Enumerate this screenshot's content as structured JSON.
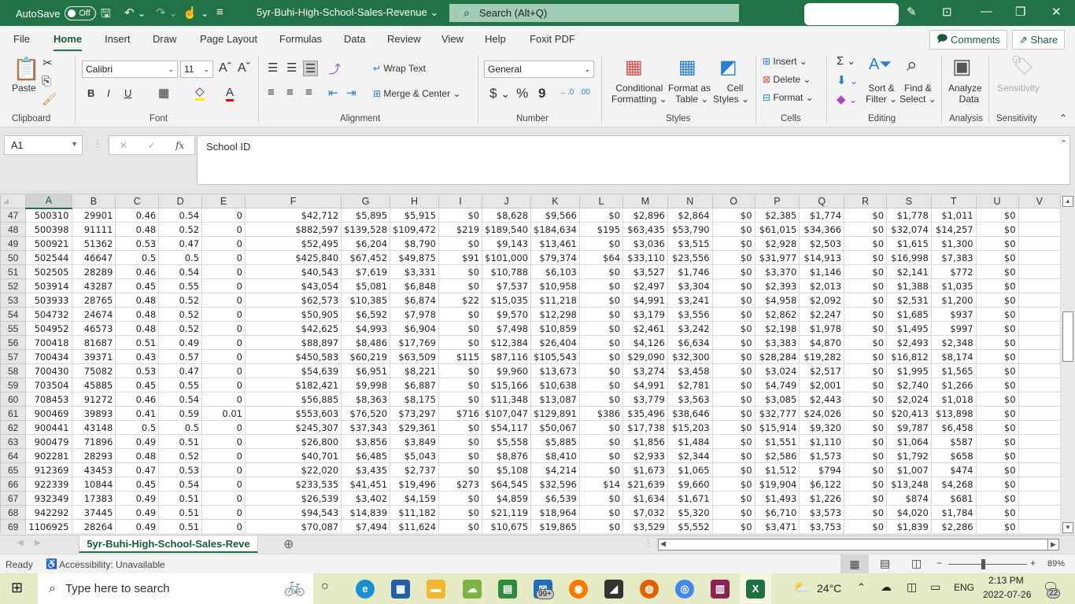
{
  "titlebar": {
    "autosave_label": "AutoSave",
    "autosave_state": "Off",
    "doc_title": "5yr-Buhi-High-School-Sales-Revenue ⌄",
    "search_placeholder": "Search (Alt+Q)"
  },
  "menu": {
    "tabs": [
      "File",
      "Home",
      "Insert",
      "Draw",
      "Page Layout",
      "Formulas",
      "Data",
      "Review",
      "View",
      "Help",
      "Foxit PDF"
    ],
    "active": "Home",
    "comments_label": "Comments",
    "share_label": "Share"
  },
  "ribbon": {
    "clipboard": {
      "paste": "Paste",
      "label": "Clipboard"
    },
    "font": {
      "family": "Calibri",
      "size": "11",
      "label": "Font",
      "bold": "B",
      "italic": "I",
      "underline": "U"
    },
    "alignment": {
      "wrap_text": "Wrap Text",
      "merge_center": "Merge & Center",
      "label": "Alignment"
    },
    "number": {
      "format": "General",
      "currency": "$",
      "percent": "%",
      "comma": "9",
      "label": "Number"
    },
    "styles": {
      "conditional_1": "Conditional",
      "conditional_2": "Formatting ⌄",
      "format_table_1": "Format as",
      "format_table_2": "Table ⌄",
      "cell_styles_1": "Cell",
      "cell_styles_2": "Styles ⌄",
      "label": "Styles"
    },
    "cells": {
      "insert": "Insert ⌄",
      "delete": "Delete ⌄",
      "format": "Format ⌄",
      "label": "Cells"
    },
    "editing": {
      "sort_1": "Sort &",
      "sort_2": "Filter ⌄",
      "find_1": "Find &",
      "find_2": "Select ⌄",
      "label": "Editing"
    },
    "analysis": {
      "analyze_1": "Analyze",
      "analyze_2": "Data",
      "label": "Analysis"
    },
    "sensitivity": {
      "button": "Sensitivity",
      "label": "Sensitivity"
    }
  },
  "formula_bar": {
    "name_box": "A1",
    "content": "School ID"
  },
  "sheet": {
    "columns": [
      "A",
      "B",
      "C",
      "D",
      "E",
      "F",
      "G",
      "H",
      "I",
      "J",
      "K",
      "L",
      "M",
      "N",
      "O",
      "P",
      "Q",
      "R",
      "S",
      "T",
      "U",
      "V"
    ],
    "rows": [
      {
        "n": "47",
        "cells": [
          "500310",
          "29901",
          "0.46",
          "0.54",
          "0",
          "$42,712",
          "$5,895",
          "$5,915",
          "$0",
          "$8,628",
          "$9,566",
          "$0",
          "$2,896",
          "$2,864",
          "$0",
          "$2,385",
          "$1,774",
          "$0",
          "$1,778",
          "$1,011",
          "$0",
          ""
        ]
      },
      {
        "n": "48",
        "cells": [
          "500398",
          "91111",
          "0.48",
          "0.52",
          "0",
          "$882,597",
          "$139,528",
          "$109,472",
          "$219",
          "$189,540",
          "$184,634",
          "$195",
          "$63,435",
          "$53,790",
          "$0",
          "$61,015",
          "$34,366",
          "$0",
          "$32,074",
          "$14,257",
          "$0",
          ""
        ]
      },
      {
        "n": "49",
        "cells": [
          "500921",
          "51362",
          "0.53",
          "0.47",
          "0",
          "$52,495",
          "$6,204",
          "$8,790",
          "$0",
          "$9,143",
          "$13,461",
          "$0",
          "$3,036",
          "$3,515",
          "$0",
          "$2,928",
          "$2,503",
          "$0",
          "$1,615",
          "$1,300",
          "$0",
          ""
        ]
      },
      {
        "n": "50",
        "cells": [
          "502544",
          "46647",
          "0.5",
          "0.5",
          "0",
          "$425,840",
          "$67,452",
          "$49,875",
          "$91",
          "$101,000",
          "$79,374",
          "$64",
          "$33,110",
          "$23,556",
          "$0",
          "$31,977",
          "$14,913",
          "$0",
          "$16,998",
          "$7,383",
          "$0",
          ""
        ]
      },
      {
        "n": "51",
        "cells": [
          "502505",
          "28289",
          "0.46",
          "0.54",
          "0",
          "$40,543",
          "$7,619",
          "$3,331",
          "$0",
          "$10,788",
          "$6,103",
          "$0",
          "$3,527",
          "$1,746",
          "$0",
          "$3,370",
          "$1,146",
          "$0",
          "$2,141",
          "$772",
          "$0",
          ""
        ]
      },
      {
        "n": "52",
        "cells": [
          "503914",
          "43287",
          "0.45",
          "0.55",
          "0",
          "$43,054",
          "$5,081",
          "$6,848",
          "$0",
          "$7,537",
          "$10,958",
          "$0",
          "$2,497",
          "$3,304",
          "$0",
          "$2,393",
          "$2,013",
          "$0",
          "$1,388",
          "$1,035",
          "$0",
          ""
        ]
      },
      {
        "n": "53",
        "cells": [
          "503933",
          "28765",
          "0.48",
          "0.52",
          "0",
          "$62,573",
          "$10,385",
          "$6,874",
          "$22",
          "$15,035",
          "$11,218",
          "$0",
          "$4,991",
          "$3,241",
          "$0",
          "$4,958",
          "$2,092",
          "$0",
          "$2,531",
          "$1,200",
          "$0",
          ""
        ]
      },
      {
        "n": "54",
        "cells": [
          "504732",
          "24674",
          "0.48",
          "0.52",
          "0",
          "$50,905",
          "$6,592",
          "$7,978",
          "$0",
          "$9,570",
          "$12,298",
          "$0",
          "$3,179",
          "$3,556",
          "$0",
          "$2,862",
          "$2,247",
          "$0",
          "$1,685",
          "$937",
          "$0",
          ""
        ]
      },
      {
        "n": "55",
        "cells": [
          "504952",
          "46573",
          "0.48",
          "0.52",
          "0",
          "$42,625",
          "$4,993",
          "$6,904",
          "$0",
          "$7,498",
          "$10,859",
          "$0",
          "$2,461",
          "$3,242",
          "$0",
          "$2,198",
          "$1,978",
          "$0",
          "$1,495",
          "$997",
          "$0",
          ""
        ]
      },
      {
        "n": "56",
        "cells": [
          "700418",
          "81687",
          "0.51",
          "0.49",
          "0",
          "$88,897",
          "$8,486",
          "$17,769",
          "$0",
          "$12,384",
          "$26,404",
          "$0",
          "$4,126",
          "$6,634",
          "$0",
          "$3,383",
          "$4,870",
          "$0",
          "$2,493",
          "$2,348",
          "$0",
          ""
        ]
      },
      {
        "n": "57",
        "cells": [
          "700434",
          "39371",
          "0.43",
          "0.57",
          "0",
          "$450,583",
          "$60,219",
          "$63,509",
          "$115",
          "$87,116",
          "$105,543",
          "$0",
          "$29,090",
          "$32,300",
          "$0",
          "$28,284",
          "$19,282",
          "$0",
          "$16,812",
          "$8,174",
          "$0",
          ""
        ]
      },
      {
        "n": "58",
        "cells": [
          "700430",
          "75082",
          "0.53",
          "0.47",
          "0",
          "$54,639",
          "$6,951",
          "$8,221",
          "$0",
          "$9,960",
          "$13,673",
          "$0",
          "$3,274",
          "$3,458",
          "$0",
          "$3,024",
          "$2,517",
          "$0",
          "$1,995",
          "$1,565",
          "$0",
          ""
        ]
      },
      {
        "n": "59",
        "cells": [
          "703504",
          "45885",
          "0.45",
          "0.55",
          "0",
          "$182,421",
          "$9,998",
          "$6,887",
          "$0",
          "$15,166",
          "$10,638",
          "$0",
          "$4,991",
          "$2,781",
          "$0",
          "$4,749",
          "$2,001",
          "$0",
          "$2,740",
          "$1,266",
          "$0",
          ""
        ]
      },
      {
        "n": "60",
        "cells": [
          "708453",
          "91272",
          "0.46",
          "0.54",
          "0",
          "$56,885",
          "$8,363",
          "$8,175",
          "$0",
          "$11,348",
          "$13,087",
          "$0",
          "$3,779",
          "$3,563",
          "$0",
          "$3,085",
          "$2,443",
          "$0",
          "$2,024",
          "$1,018",
          "$0",
          ""
        ]
      },
      {
        "n": "61",
        "cells": [
          "900469",
          "39893",
          "0.41",
          "0.59",
          "0.01",
          "$553,603",
          "$76,520",
          "$73,297",
          "$716",
          "$107,047",
          "$129,891",
          "$386",
          "$35,496",
          "$38,646",
          "$0",
          "$32,777",
          "$24,026",
          "$0",
          "$20,413",
          "$13,898",
          "$0",
          ""
        ]
      },
      {
        "n": "62",
        "cells": [
          "900441",
          "43148",
          "0.5",
          "0.5",
          "0",
          "$245,307",
          "$37,343",
          "$29,361",
          "$0",
          "$54,117",
          "$50,067",
          "$0",
          "$17,738",
          "$15,203",
          "$0",
          "$15,914",
          "$9,320",
          "$0",
          "$9,787",
          "$6,458",
          "$0",
          ""
        ]
      },
      {
        "n": "63",
        "cells": [
          "900479",
          "71896",
          "0.49",
          "0.51",
          "0",
          "$26,800",
          "$3,856",
          "$3,849",
          "$0",
          "$5,558",
          "$5,885",
          "$0",
          "$1,856",
          "$1,484",
          "$0",
          "$1,551",
          "$1,110",
          "$0",
          "$1,064",
          "$587",
          "$0",
          ""
        ]
      },
      {
        "n": "64",
        "cells": [
          "902281",
          "28293",
          "0.48",
          "0.52",
          "0",
          "$40,701",
          "$6,485",
          "$5,043",
          "$0",
          "$8,876",
          "$8,410",
          "$0",
          "$2,933",
          "$2,344",
          "$0",
          "$2,586",
          "$1,573",
          "$0",
          "$1,792",
          "$658",
          "$0",
          ""
        ]
      },
      {
        "n": "65",
        "cells": [
          "912369",
          "43453",
          "0.47",
          "0.53",
          "0",
          "$22,020",
          "$3,435",
          "$2,737",
          "$0",
          "$5,108",
          "$4,214",
          "$0",
          "$1,673",
          "$1,065",
          "$0",
          "$1,512",
          "$794",
          "$0",
          "$1,007",
          "$474",
          "$0",
          ""
        ]
      },
      {
        "n": "66",
        "cells": [
          "922339",
          "10844",
          "0.45",
          "0.54",
          "0",
          "$233,535",
          "$41,451",
          "$19,496",
          "$273",
          "$64,545",
          "$32,596",
          "$14",
          "$21,639",
          "$9,660",
          "$0",
          "$19,904",
          "$6,122",
          "$0",
          "$13,248",
          "$4,268",
          "$0",
          ""
        ]
      },
      {
        "n": "67",
        "cells": [
          "932349",
          "17383",
          "0.49",
          "0.51",
          "0",
          "$26,539",
          "$3,402",
          "$4,159",
          "$0",
          "$4,859",
          "$6,539",
          "$0",
          "$1,634",
          "$1,671",
          "$0",
          "$1,493",
          "$1,226",
          "$0",
          "$874",
          "$681",
          "$0",
          ""
        ]
      },
      {
        "n": "68",
        "cells": [
          "942292",
          "37445",
          "0.49",
          "0.51",
          "0",
          "$94,543",
          "$14,839",
          "$11,182",
          "$0",
          "$21,119",
          "$18,964",
          "$0",
          "$7,032",
          "$5,320",
          "$0",
          "$6,710",
          "$3,573",
          "$0",
          "$4,020",
          "$1,784",
          "$0",
          ""
        ]
      },
      {
        "n": "69",
        "cells": [
          "1106925",
          "28264",
          "0.49",
          "0.51",
          "0",
          "$70,087",
          "$7,494",
          "$11,624",
          "$0",
          "$10,675",
          "$19,865",
          "$0",
          "$3,529",
          "$5,552",
          "$0",
          "$3,471",
          "$3,753",
          "$0",
          "$1,839",
          "$2,286",
          "$0",
          ""
        ]
      }
    ]
  },
  "sheet_tabs": {
    "active": "5yr-Buhi-High-School-Sales-Reve"
  },
  "status": {
    "ready": "Ready",
    "accessibility": "Accessibility: Unavailable",
    "zoom": "89%"
  },
  "taskbar": {
    "search_placeholder": "Type here to search",
    "mail_badge": "99+",
    "weather": "24°C",
    "language": "ENG",
    "time": "2:13 PM",
    "date": "2022-07-26",
    "notifications": "22"
  },
  "colors": {
    "accent": "#217346",
    "search_bg": "#a0cdb4"
  }
}
